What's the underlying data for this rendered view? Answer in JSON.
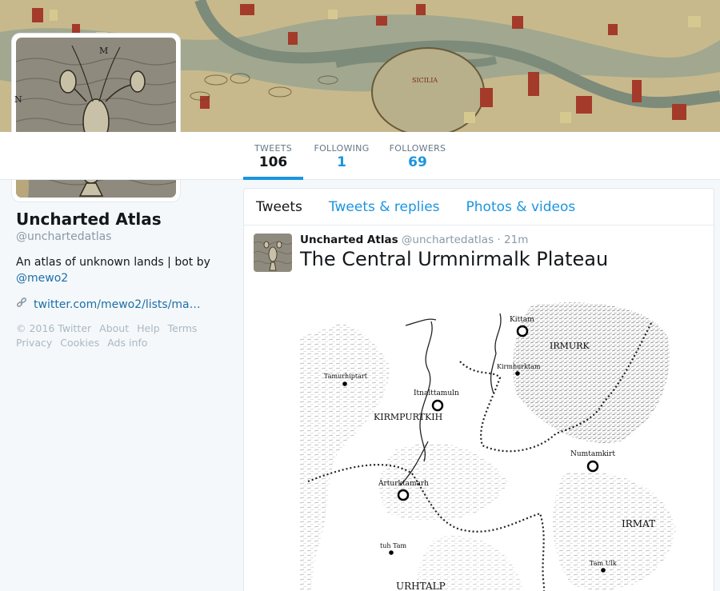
{
  "profile": {
    "name": "Uncharted Atlas",
    "handle": "@unchartedatlas",
    "bio_text": "An atlas of unknown lands | bot by",
    "bio_mention": "@mewo2",
    "url": "twitter.com/mewo2/lists/ma…"
  },
  "avatar_letters": {
    "top": "M",
    "left": "N"
  },
  "stats": [
    {
      "label": "TWEETS",
      "value": "106"
    },
    {
      "label": "FOLLOWING",
      "value": "1"
    },
    {
      "label": "FOLLOWERS",
      "value": "69"
    }
  ],
  "footer": [
    "© 2016 Twitter",
    "About",
    "Help",
    "Terms",
    "Privacy",
    "Cookies",
    "Ads info"
  ],
  "tabs": [
    "Tweets",
    "Tweets & replies",
    "Photos & videos"
  ],
  "tweet": {
    "name": "Uncharted Atlas",
    "handle": "@unchartedatlas",
    "sep": "·",
    "time": "21m",
    "text": "The Central Urmnirmalk Plateau"
  },
  "map_labels": {
    "kittam": "Kittam",
    "irmurk": "IRMURK",
    "kirmhurktam": "Kirmhurktam",
    "tamurhiptart": "Tamurhiptart",
    "itnalttamuln": "Itnalttamuln",
    "kirmpurtkih": "KIRMPURTKIH",
    "numtamkirt": "Numtamkirt",
    "arturktamarh": "Arturktamarh",
    "irmat": "IRMAT",
    "tuhtam": "tuh Tam",
    "tamulk": "Tam Ulk",
    "urhtalp": "URHTALP"
  },
  "banner_label": "SICILIA",
  "colors": {
    "accent": "#1b95e0",
    "link": "#1b6fa8",
    "muted": "#8a9aa8"
  }
}
